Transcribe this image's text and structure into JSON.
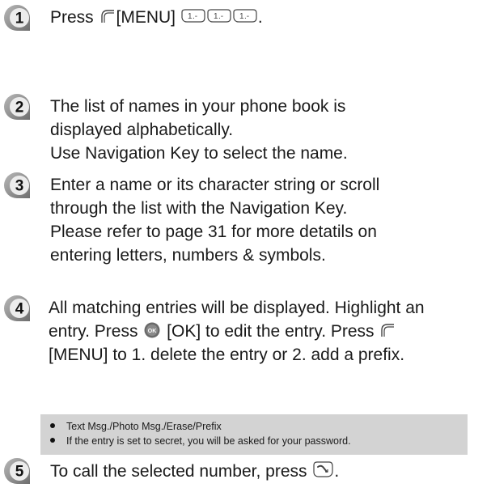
{
  "steps": [
    {
      "number": "1",
      "parts": [
        "Press ",
        "[MENU]",
        "."
      ]
    },
    {
      "number": "2",
      "lines": [
        "The list of names in your phone book is",
        "displayed alphabetically.",
        "Use Navigation Key to select the name."
      ]
    },
    {
      "number": "3",
      "lines": [
        "Enter a name or its character string or scroll",
        "through the list with the Navigation Key.",
        "Please refer to page 31 for more detatils on",
        "entering letters, numbers & symbols."
      ]
    },
    {
      "number": "4",
      "line1": "All matching entries will be displayed. Highlight an",
      "line2_a": "entry. Press ",
      "line2_b": "[OK] to edit the entry.  Press ",
      "line3": "[MENU] to 1. delete the entry or 2. add a prefix."
    },
    {
      "number": "5",
      "parts": [
        "To call the selected number, press ",
        "."
      ]
    }
  ],
  "notes": [
    "Text Msg./Photo Msg./Erase/Prefix",
    "If the entry is set to secret, you will be asked for your password."
  ],
  "icons": {
    "menu_key": "soft-key-icon",
    "one_key": "one-key-icon",
    "ok_key": "ok-button-icon",
    "send_key": "send-key-icon"
  },
  "colors": {
    "badge_gray": "#9a9a9a",
    "badge_light": "#e6e6e6",
    "note_bg": "#d3d3d3"
  }
}
